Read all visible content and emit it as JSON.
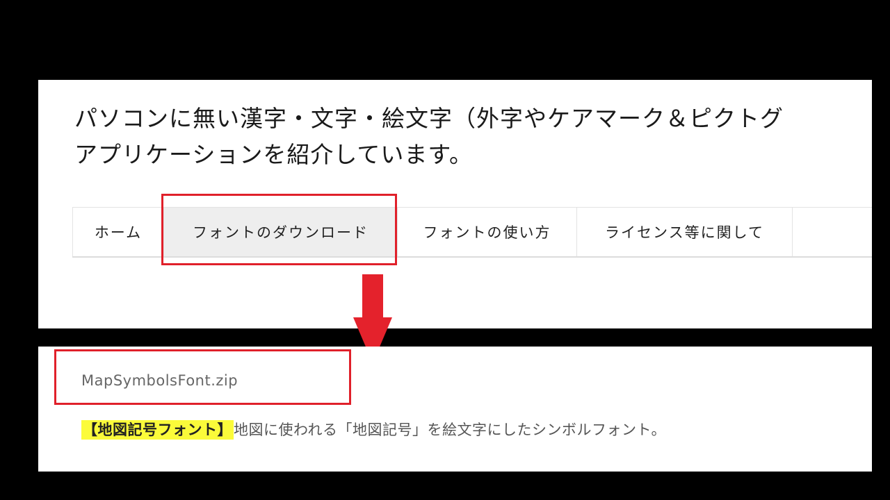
{
  "headline": {
    "line1": "パソコンに無い漢字・文字・絵文字（外字やケアマーク＆ピクトグ",
    "line2": "アプリケーションを紹介しています。"
  },
  "nav": {
    "items": [
      {
        "label": "ホーム"
      },
      {
        "label": "フォントのダウンロード",
        "active": true
      },
      {
        "label": "フォントの使い方"
      },
      {
        "label": "ライセンス等に関して"
      }
    ]
  },
  "download": {
    "filename": "MapSymbolsFont.zip",
    "tag": "【地図記号フォント】",
    "description": "地図に使われる「地図記号」を絵文字にしたシンボルフォント。"
  },
  "colors": {
    "highlight_box": "#e0202a",
    "arrow": "#e4222c",
    "tag_background": "#fbfb3a"
  },
  "icons": {
    "arrow": "arrow-down-icon"
  }
}
